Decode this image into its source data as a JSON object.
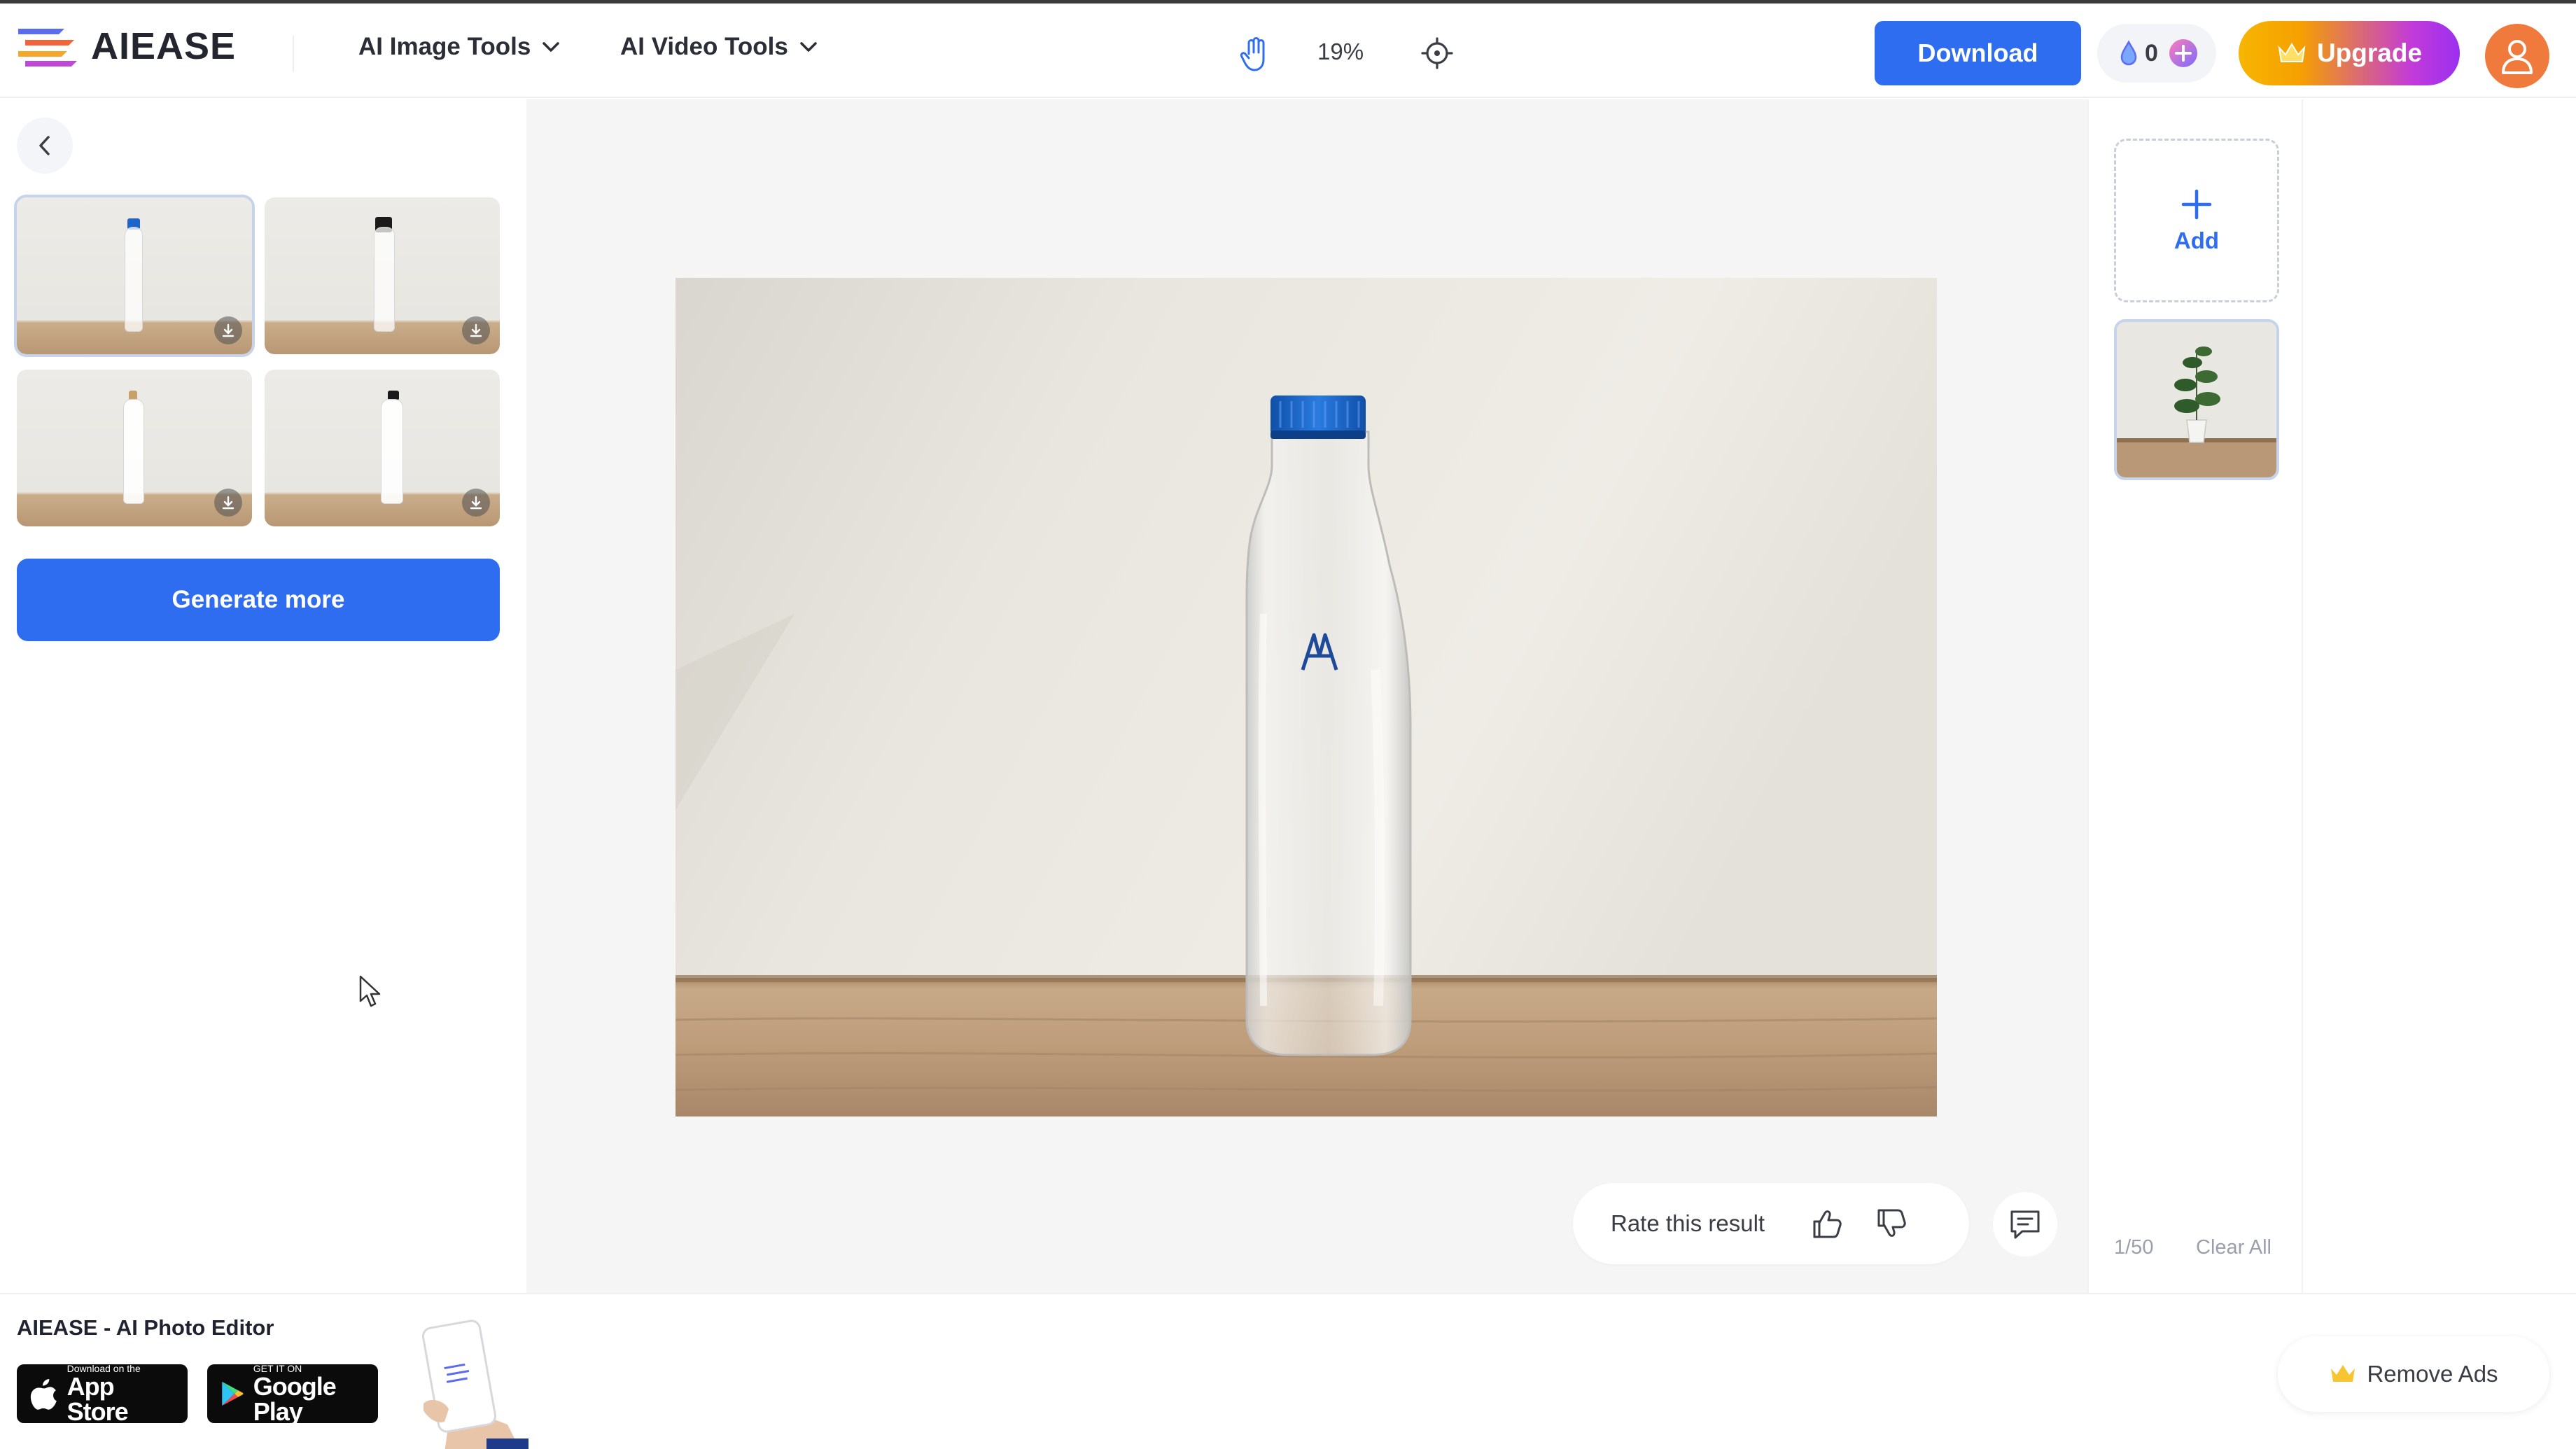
{
  "header": {
    "logo_text": "AIEASE",
    "nav": [
      {
        "label": "AI Image Tools"
      },
      {
        "label": "AI Video Tools"
      }
    ],
    "zoom": "19%",
    "download_label": "Download",
    "credits": "0",
    "upgrade_label": "Upgrade"
  },
  "left_panel": {
    "generate_label": "Generate more",
    "thumbnails": [
      {
        "cap_color": "#1f64c8",
        "selected": true
      },
      {
        "cap_color": "#1a1a1a",
        "selected": false
      },
      {
        "cap_color": "#c8a06a",
        "selected": false
      },
      {
        "cap_color": "#1a1a1a",
        "selected": false
      }
    ]
  },
  "canvas": {
    "rate_label": "Rate this result",
    "bottle_cap_color": "#1f64c8"
  },
  "right_panel": {
    "add_label": "Add",
    "page_count": "1/50",
    "clear_label": "Clear All"
  },
  "bottom": {
    "promo_title": "AIEASE - AI Photo Editor",
    "appstore_small": "Download on the",
    "appstore_big": "App Store",
    "google_small": "GET IT ON",
    "google_big": "Google Play",
    "remove_ads_label": "Remove Ads"
  },
  "colors": {
    "accent": "#2f6df0",
    "avatar": "#f07a3b"
  },
  "icons": {
    "back": "chevron-left-icon",
    "hand": "hand-icon",
    "target": "crosshair-icon",
    "thumbs_up": "thumbs-up-icon",
    "thumbs_down": "thumbs-down-icon",
    "feedback": "chat-icon",
    "crown": "crown-icon"
  }
}
